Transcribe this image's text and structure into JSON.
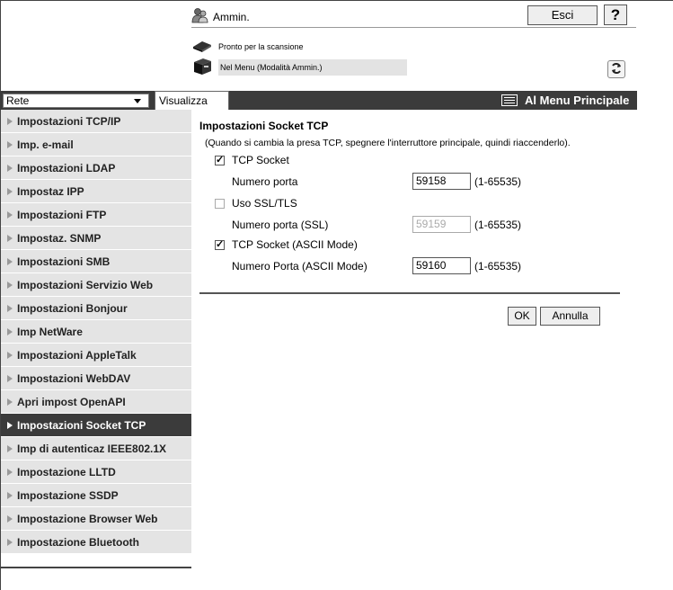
{
  "header": {
    "user_label": "Ammin.",
    "user_icon": "admin-users-icon",
    "logout_label": "Esci",
    "help_label": "?",
    "status_ready": "Pronto per la scansione",
    "status_menu": "Nel Menu (Modalità Ammin.)",
    "refresh_icon": "refresh-icon"
  },
  "toolbar": {
    "category_select": "Rete",
    "view_tab": "Visualizza",
    "main_menu_label": "Al Menu Principale"
  },
  "sidebar": {
    "items": [
      {
        "label": "Impostazioni TCP/IP"
      },
      {
        "label": "Imp. e-mail"
      },
      {
        "label": "Impostazioni LDAP"
      },
      {
        "label": "Impostaz IPP"
      },
      {
        "label": "Impostazioni FTP"
      },
      {
        "label": "Impostaz. SNMP"
      },
      {
        "label": "Impostazioni SMB"
      },
      {
        "label": "Impostazioni Servizio Web"
      },
      {
        "label": "Impostazioni Bonjour"
      },
      {
        "label": "Imp NetWare"
      },
      {
        "label": "Impostazioni AppleTalk"
      },
      {
        "label": "Impostazioni WebDAV"
      },
      {
        "label": "Apri impost OpenAPI"
      },
      {
        "label": "Impostazioni Socket TCP",
        "active": true
      },
      {
        "label": "Imp di autenticaz IEEE802.1X"
      },
      {
        "label": "Impostazione LLTD"
      },
      {
        "label": "Impostazione SSDP"
      },
      {
        "label": "Impostazione Browser Web"
      },
      {
        "label": "Impostazione Bluetooth"
      }
    ]
  },
  "main": {
    "title": "Impostazioni Socket TCP",
    "note": "(Quando si cambia la presa TCP, spegnere l'interruttore principale, quindi riaccenderlo).",
    "tcp_socket": {
      "label": "TCP Socket",
      "checked": true
    },
    "port": {
      "label": "Numero porta",
      "value": "59158",
      "range": "(1-65535)"
    },
    "ssl": {
      "label": "Uso SSL/TLS",
      "checked": false
    },
    "port_ssl": {
      "label": "Numero porta (SSL)",
      "value": "59159",
      "range": "(1-65535)",
      "disabled": true
    },
    "ascii": {
      "label": "TCP Socket (ASCII Mode)",
      "checked": true
    },
    "port_ascii": {
      "label": "Numero Porta (ASCII Mode)",
      "value": "59160",
      "range": "(1-65535)"
    },
    "ok_label": "OK",
    "cancel_label": "Annulla"
  }
}
